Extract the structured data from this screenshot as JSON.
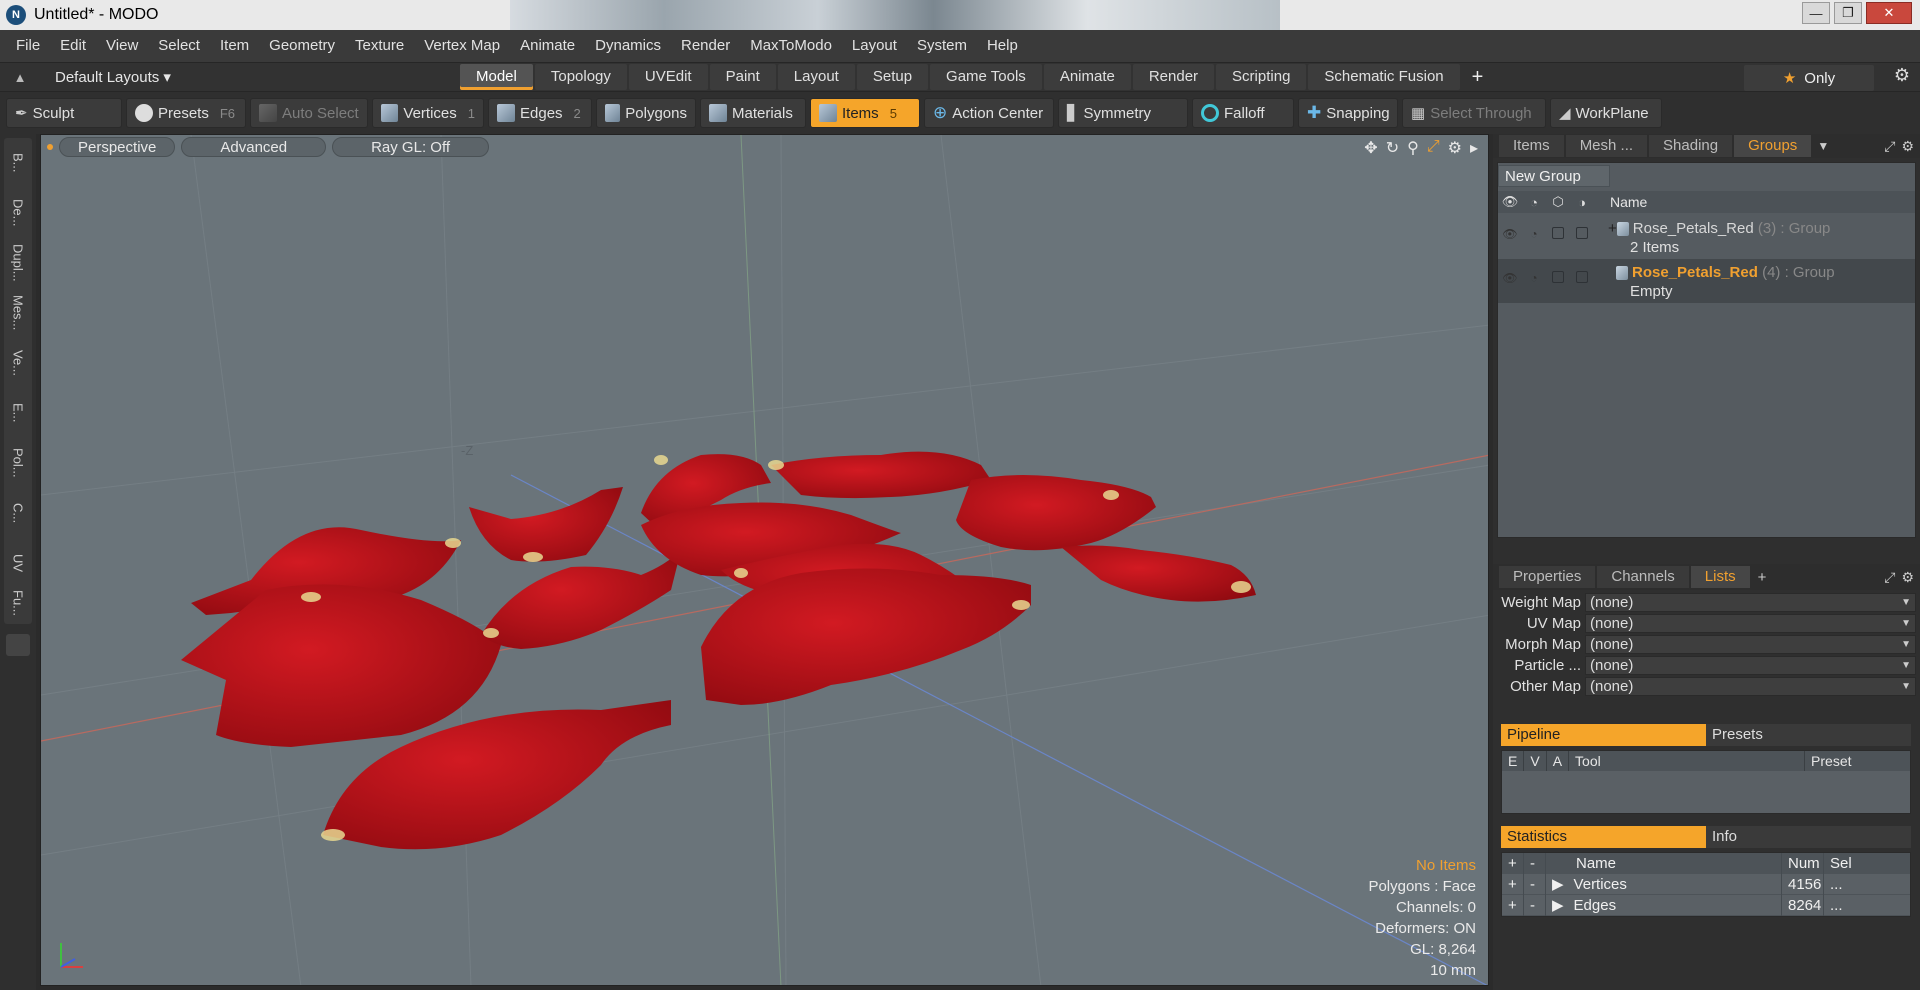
{
  "window": {
    "title": "Untitled* - MODO",
    "logo": "N"
  },
  "menu": [
    "File",
    "Edit",
    "View",
    "Select",
    "Item",
    "Geometry",
    "Texture",
    "Vertex Map",
    "Animate",
    "Dynamics",
    "Render",
    "MaxToModo",
    "Layout",
    "System",
    "Help"
  ],
  "layoutbar": {
    "layouts_label": "Default Layouts",
    "tabs": [
      "Model",
      "Topology",
      "UVEdit",
      "Paint",
      "Layout",
      "Setup",
      "Game Tools",
      "Animate",
      "Render",
      "Scripting",
      "Schematic Fusion"
    ],
    "active_tab": "Model",
    "only_label": "Only"
  },
  "toolbar": {
    "sculpt": "Sculpt",
    "presets": "Presets",
    "presets_key": "F6",
    "auto_select": "Auto Select",
    "vertices": "Vertices",
    "vertices_key": "1",
    "edges": "Edges",
    "edges_key": "2",
    "polygons": "Polygons",
    "materials": "Materials",
    "items": "Items",
    "items_key": "5",
    "action_center": "Action Center",
    "symmetry": "Symmetry",
    "falloff": "Falloff",
    "snapping": "Snapping",
    "select_through": "Select Through",
    "workplane": "WorkPlane"
  },
  "sidebar": [
    "B...",
    "De...",
    "Dupl...",
    "Mes...",
    "Ve...",
    "E...",
    "Pol...",
    "C...",
    "UV",
    "Fu..."
  ],
  "viewport": {
    "view_mode": "Perspective",
    "advanced": "Advanced",
    "raygl": "Ray GL: Off",
    "axis_label": "-Z",
    "stats": {
      "items": "No Items",
      "polygons": "Polygons : Face",
      "channels": "Channels: 0",
      "deformers": "Deformers: ON",
      "gl": "GL: 8,264",
      "scale": "10 mm"
    },
    "petal_color": "#c0121a",
    "background_color": "#6a747a"
  },
  "items_panel": {
    "tabs": [
      "Items",
      "Mesh ...",
      "Shading",
      "Groups"
    ],
    "active_tab": "Groups",
    "new_group": "New Group",
    "name_header": "Name",
    "groups": [
      {
        "name": "Rose_Petals_Red",
        "meta": "(3) : Group",
        "sub": "2 Items",
        "selected": false
      },
      {
        "name": "Rose_Petals_Red",
        "meta": "(4) : Group",
        "sub": "Empty",
        "selected": true
      }
    ]
  },
  "properties_panel": {
    "tabs": [
      "Properties",
      "Channels",
      "Lists"
    ],
    "active_tab": "Lists",
    "lists": [
      {
        "label": "Weight Map",
        "value": "(none)"
      },
      {
        "label": "UV Map",
        "value": "(none)"
      },
      {
        "label": "Morph Map",
        "value": "(none)"
      },
      {
        "label": "Particle ...",
        "value": "(none)"
      },
      {
        "label": "Other Map",
        "value": "(none)"
      }
    ],
    "pipeline": {
      "tab": "Pipeline",
      "other_tab": "Presets",
      "columns": [
        "E",
        "V",
        "A",
        "Tool",
        "Preset"
      ]
    },
    "statistics": {
      "tab": "Statistics",
      "other_tab": "Info",
      "columns": [
        "+",
        "-",
        "Name",
        "Num",
        "Sel"
      ],
      "rows": [
        {
          "plus": "+",
          "minus": "-",
          "name": "Vertices",
          "num": "4156",
          "sel": "..."
        },
        {
          "plus": "+",
          "minus": "-",
          "name": "Edges",
          "num": "8264",
          "sel": "..."
        }
      ]
    }
  }
}
